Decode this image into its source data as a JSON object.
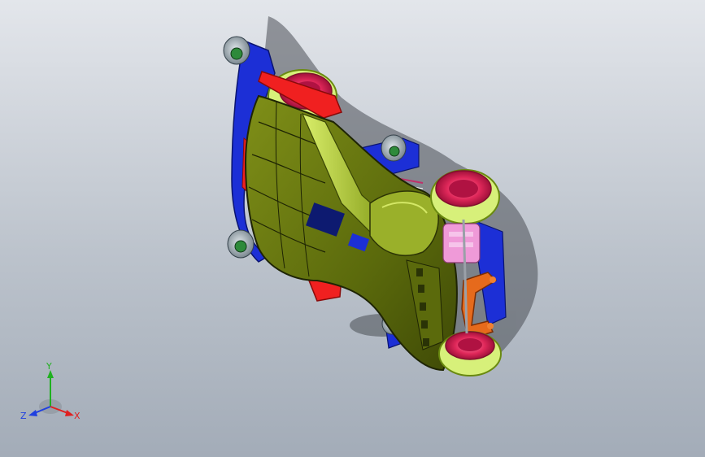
{
  "triad": {
    "labels": {
      "x": "X",
      "y": "Y",
      "z": "Z"
    },
    "colors": {
      "x": "#e02020",
      "y": "#20b020",
      "z": "#2040e0"
    }
  },
  "palette": {
    "background_top": "#e3e6eb",
    "background_bottom": "#a3acb8",
    "body": "#6b7a10",
    "body_highlight": "#b9d43a",
    "wheel_rim": "#d7f07a",
    "wheel_hub": "#e0285a",
    "chassis": "#1c2fd6",
    "wing": "#f02020",
    "roller": "#9aa7b0",
    "gear": "#ef9ad8",
    "bumper": "#e66a1c"
  }
}
